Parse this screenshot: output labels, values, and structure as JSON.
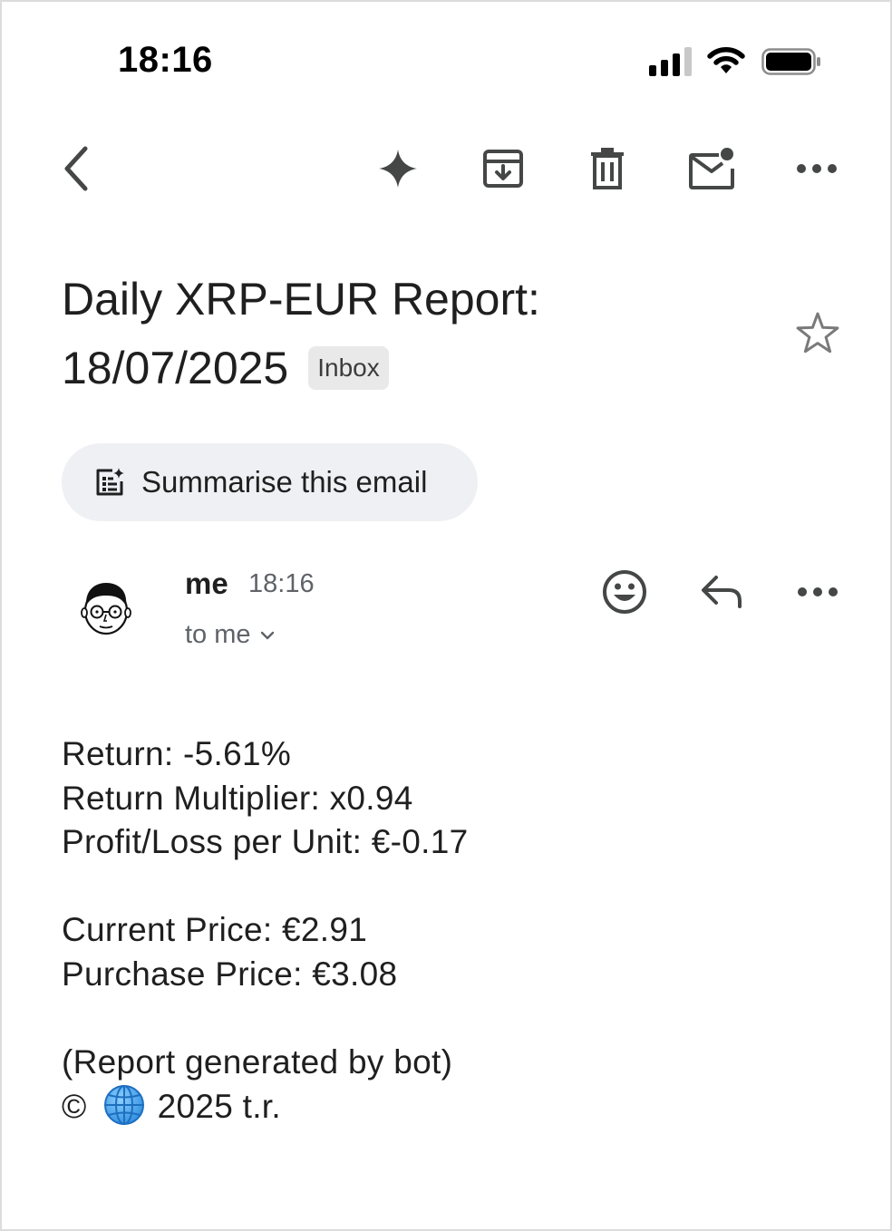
{
  "status_bar": {
    "time": "18:16"
  },
  "toolbar": {
    "back": "back-icon",
    "icons": [
      "gemini-sparkle-icon",
      "archive-icon",
      "delete-icon",
      "mark-unread-icon",
      "more-icon"
    ]
  },
  "subject": {
    "line1": "Daily XRP-EUR Report:",
    "line2": "18/07/2025",
    "label": "Inbox"
  },
  "summarise": {
    "label": "Summarise this email"
  },
  "sender": {
    "name": "me",
    "time": "18:16",
    "recipient": "to me"
  },
  "body": {
    "return": "Return: -5.61%",
    "multiplier": "Return Multiplier: x0.94",
    "pl": "Profit/Loss per Unit: €-0.17",
    "current": "Current Price: €2.91",
    "purchase": "Purchase Price: €3.08",
    "note": "(Report generated by bot)",
    "copyright_symbol": "©",
    "copyright_text": "2025 t.r."
  },
  "colors": {
    "icon": "#444746",
    "chip_bg": "#eef0f4",
    "secondary_text": "#5f6368"
  }
}
